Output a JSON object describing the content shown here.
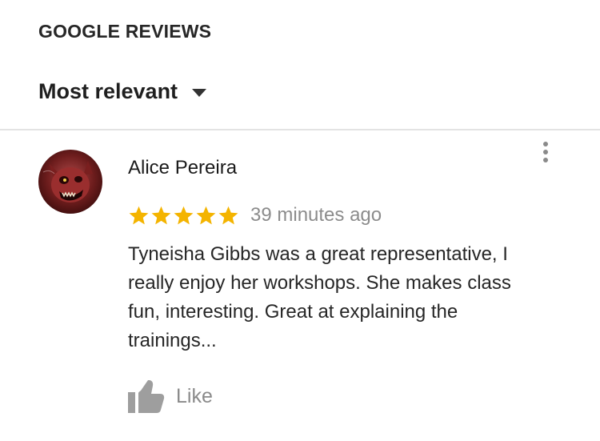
{
  "section": {
    "title": "GOOGLE REVIEWS"
  },
  "sort": {
    "label": "Most relevant"
  },
  "review": {
    "author": "Alice Pereira",
    "rating": 5,
    "rating_max": 5,
    "time": "39 minutes ago",
    "text": "Tyneisha Gibbs  was a great representative,  I\nreally enjoy her workshops. She makes class\nfun, interesting.  Great at explaining  the\ntrainings...",
    "like_label": "Like",
    "icons": {
      "avatar": "avatar-image",
      "more": "more-vert-icon",
      "like": "thumbs-up-icon",
      "star": "star-icon"
    }
  },
  "colors": {
    "star": "#f4b400",
    "muted": "#8c8c8c",
    "divider": "#e3e3e3"
  }
}
